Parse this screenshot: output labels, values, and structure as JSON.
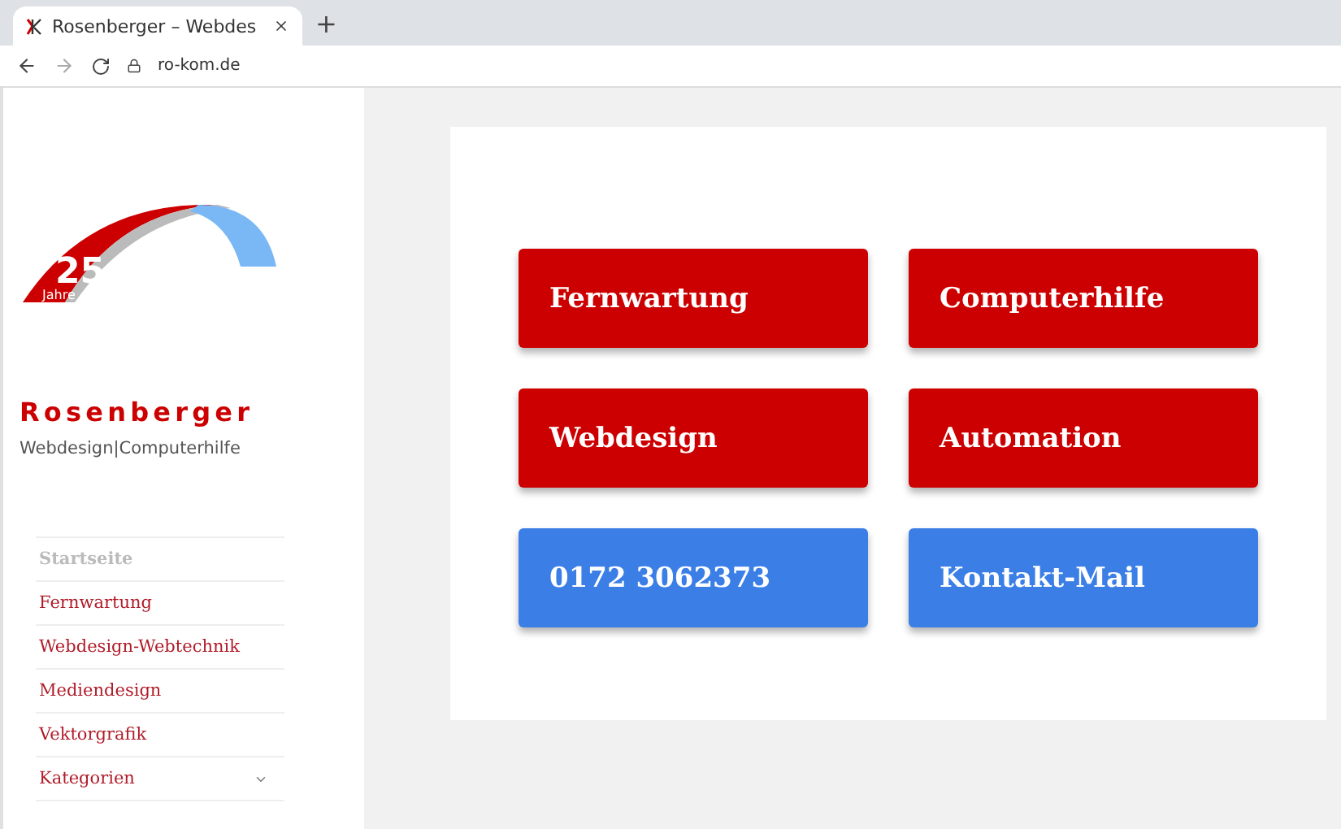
{
  "browser": {
    "tab_title": "Rosenberger – Webdes",
    "new_tab": "+",
    "url": "ro-kom.de"
  },
  "sidebar": {
    "logo_number": "25",
    "logo_caption": "Jahre",
    "site_title": "Rosenberger",
    "tagline": "Webdesign|Computerhilfe",
    "menu": [
      {
        "label": "Startseite",
        "selected": true
      },
      {
        "label": "Fernwartung",
        "selected": false
      },
      {
        "label": "Webdesign-Webtechnik",
        "selected": false
      },
      {
        "label": "Mediendesign",
        "selected": false
      },
      {
        "label": "Vektorgrafik",
        "selected": false
      },
      {
        "label": "Kategorien",
        "selected": false,
        "expanded": false
      }
    ]
  },
  "tiles": [
    {
      "label": "Fernwartung",
      "color": "#cc0000"
    },
    {
      "label": "Computerhilfe",
      "color": "#cc0000"
    },
    {
      "label": "Webdesign",
      "color": "#cc0000"
    },
    {
      "label": "Automation",
      "color": "#cc0000"
    },
    {
      "label": "0172 3062373",
      "color": "#3a7ee6"
    },
    {
      "label": "Kontakt-Mail",
      "color": "#3a7ee6"
    }
  ]
}
